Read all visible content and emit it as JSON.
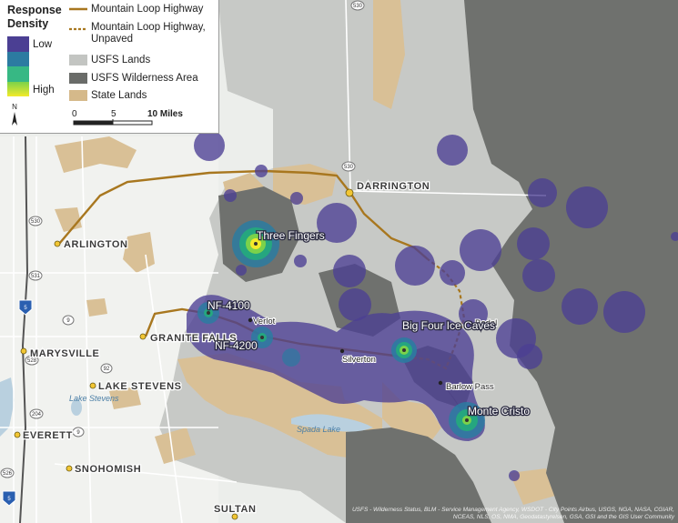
{
  "legend": {
    "density_title": "Response Density",
    "low": "Low",
    "high": "High",
    "ramp_colors": [
      "#4b3f93",
      "#2c7ba1",
      "#25a67f",
      "#7bd24a",
      "#f3ea2a"
    ],
    "items": [
      {
        "label": "Mountain Loop Highway",
        "color": "#a8771f",
        "type": "solid-line"
      },
      {
        "label": "Mountain Loop Highway, Unpaved",
        "color": "#a8771f",
        "type": "dashed-line"
      },
      {
        "label": "USFS Lands",
        "color": "#c3c5c2",
        "type": "fill"
      },
      {
        "label": "USFS Wilderness Area",
        "color": "#6a6c69",
        "type": "fill"
      },
      {
        "label": "State Lands",
        "color": "#d5b98a",
        "type": "fill"
      }
    ],
    "scale": {
      "ticks": [
        "0",
        "5",
        "10 Miles"
      ]
    },
    "north": "N"
  },
  "places": {
    "darrington": "DARRINGTON",
    "arlington": "ARLINGTON",
    "marysville": "MARYSVILLE",
    "granite_falls": "GRANITE FALLS",
    "lake_stevens": "LAKE STEVENS",
    "lake_stevens_water": "Lake Stevens",
    "everett": "EVERETT",
    "snohomish": "SNOHOMISH",
    "sultan": "SULTAN",
    "spada_lake": "Spada Lake",
    "verlot": "Verlot",
    "silverton": "Silverton",
    "bedal": "Bedal",
    "barlow_pass": "Barlow Pass"
  },
  "hotspots": {
    "three_fingers": "Three Fingers",
    "nf4100": "NF-4100",
    "nf4200": "NF-4200",
    "big_four": "Big Four Ice Caves",
    "monte_cristo": "Monte Cristo"
  },
  "shields": [
    "530",
    "530",
    "531",
    "5",
    "9",
    "528",
    "92",
    "9",
    "204",
    "526",
    "5",
    "530"
  ],
  "attribution": "USFS - Wilderness Status, BLM - Service Management Agency, WSDOT - City Points Airbus, USGS, NGA, NASA, CGIAR, NCEAS, NLS, OS, NMA, Geodatastyrelsen, GSA, GSI and the GIS User Community"
}
